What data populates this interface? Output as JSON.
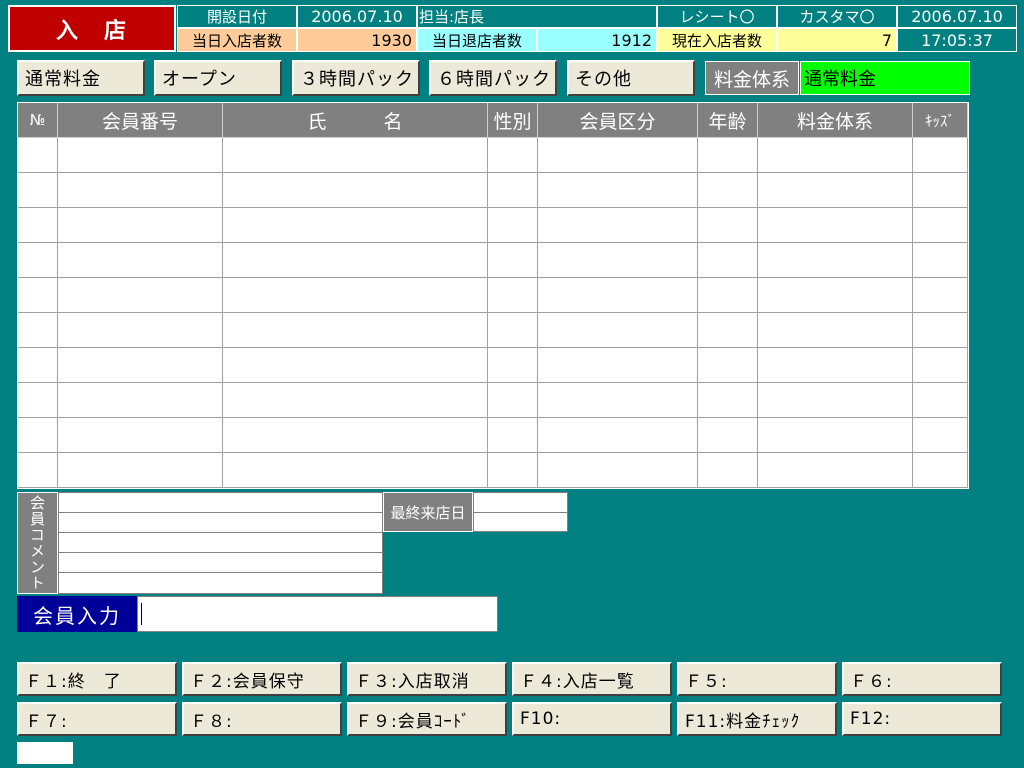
{
  "header": {
    "title": "入　店",
    "open_date_label": "開設日付",
    "open_date": "2006.07.10",
    "staff": "担当:店長",
    "receipt": "レシート〇",
    "customer": "カスタマ〇",
    "current_date": "2006.07.10",
    "today_in_label": "当日入店者数",
    "today_in": "1930",
    "today_out_label": "当日退店者数",
    "today_out": "1912",
    "current_in_label": "現在入店者数",
    "current_in": "7",
    "time": "17:05:37"
  },
  "plans": {
    "normal": "通常料金",
    "open": "オープン",
    "pack3": "３時間パック",
    "pack6": "６時間パック",
    "other": "その他",
    "fee_label": "料金体系",
    "fee_value": "通常料金"
  },
  "table": {
    "headers": [
      "№",
      "会員番号",
      "氏　　　名",
      "性別",
      "会員区分",
      "年齢",
      "料金体系",
      "ｷｯｽﾞ"
    ],
    "row_count": 10
  },
  "comment": {
    "label": "会員コメント",
    "last_visit_label": "最終来店日"
  },
  "member_input": {
    "label": "会員入力",
    "value": ""
  },
  "fkeys": [
    "Ｆ１:終　了",
    "Ｆ２:会員保守",
    "Ｆ３:入店取消",
    "Ｆ４:入店一覧",
    "Ｆ５:",
    "Ｆ６:",
    "Ｆ７:",
    "Ｆ８:",
    "Ｆ９:会員ｺｰﾄﾞ",
    "F10:",
    "F11:料金ﾁｪｯｸ",
    "F12:"
  ],
  "colors": {
    "background": "#008080",
    "title_bg": "#c00000",
    "today_in_bg": "#ffcc99",
    "today_out_bg": "#99ffff",
    "current_in_bg": "#ffff99",
    "fee_value_bg": "#00ff00",
    "member_input_label_bg": "#000099"
  }
}
